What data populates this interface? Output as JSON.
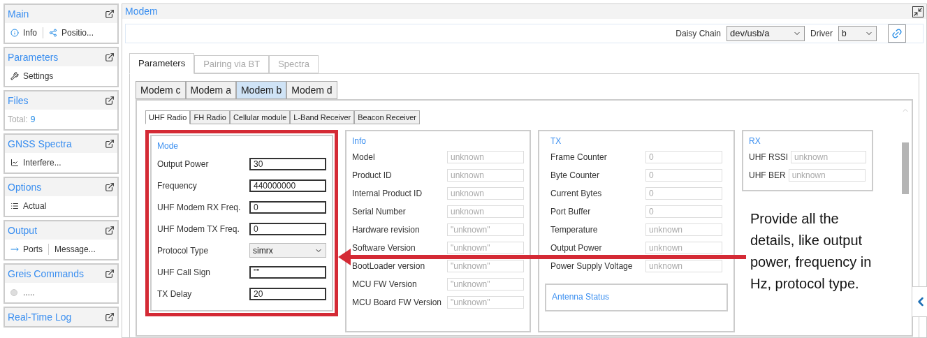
{
  "sidebar": {
    "panels": [
      {
        "title": "Main",
        "items": [
          {
            "kind": "info",
            "label": "Info"
          },
          {
            "kind": "position",
            "label": "Positio..."
          }
        ]
      },
      {
        "title": "Parameters",
        "items": [
          {
            "kind": "settings",
            "label": "Settings"
          }
        ]
      },
      {
        "title": "Files",
        "items": [
          {
            "kind": "total",
            "label": "Total:",
            "value": "9"
          }
        ]
      },
      {
        "title": "GNSS Spectra",
        "items": [
          {
            "kind": "chart",
            "label": "Interfere..."
          }
        ]
      },
      {
        "title": "Options",
        "items": [
          {
            "kind": "list",
            "label": "Actual"
          }
        ]
      },
      {
        "title": "Output",
        "items": [
          {
            "kind": "ports",
            "label": "Ports"
          },
          {
            "kind": "text",
            "label": "Message..."
          }
        ]
      },
      {
        "title": "Greis Commands",
        "items": [
          {
            "kind": "status",
            "label": "....."
          }
        ]
      },
      {
        "title": "Real-Time Log"
      }
    ]
  },
  "main": {
    "title": "Modem",
    "toolbar": {
      "daisy_chain": {
        "label": "Daisy Chain",
        "value": "dev/usb/a"
      },
      "driver": {
        "label": "Driver",
        "value": "b"
      }
    },
    "tabs": [
      {
        "label": "Parameters",
        "selected": true,
        "disabled": false
      },
      {
        "label": "Pairing via BT",
        "selected": false,
        "disabled": true
      },
      {
        "label": "Spectra",
        "selected": false,
        "disabled": true
      }
    ],
    "modem_tabs": [
      {
        "label": "Modem c",
        "selected": false
      },
      {
        "label": "Modem a",
        "selected": false
      },
      {
        "label": "Modem b",
        "selected": true
      },
      {
        "label": "Modem d",
        "selected": false
      }
    ],
    "radio_tabs": [
      {
        "label": "UHF Radio",
        "selected": true
      },
      {
        "label": "FH Radio",
        "selected": false
      },
      {
        "label": "Cellular module",
        "selected": false
      },
      {
        "label": "L-Band Receiver",
        "selected": false
      },
      {
        "label": "Beacon Receiver",
        "selected": false
      }
    ],
    "mode": {
      "title": "Mode",
      "fields": [
        {
          "kind": "input",
          "label": "Output Power",
          "value": "30"
        },
        {
          "kind": "input",
          "label": "Frequency",
          "value": "440000000"
        },
        {
          "kind": "input",
          "label": "UHF Modem RX Freq.",
          "value": "0"
        },
        {
          "kind": "input",
          "label": "UHF Modem TX Freq.",
          "value": "0"
        },
        {
          "kind": "select",
          "label": "Protocol Type",
          "value": "simrx"
        },
        {
          "kind": "input",
          "label": "UHF Call Sign",
          "value": "\"\""
        },
        {
          "kind": "input",
          "label": "TX Delay",
          "value": "20"
        }
      ]
    },
    "info": {
      "title": "Info",
      "fields": [
        {
          "label": "Model",
          "value": "unknown"
        },
        {
          "label": "Product ID",
          "value": "unknown"
        },
        {
          "label": "Internal Product ID",
          "value": "unknown"
        },
        {
          "label": "Serial Number",
          "value": "unknown"
        },
        {
          "label": "Hardware revision",
          "value": "\"unknown\""
        },
        {
          "label": "Software Version",
          "value": "\"unknown\""
        },
        {
          "label": "BootLoader version",
          "value": "\"unknown\""
        },
        {
          "label": "MCU FW Version",
          "value": "\"unknown\""
        },
        {
          "label": "MCU Board FW Version",
          "value": "\"unknown\""
        }
      ]
    },
    "tx": {
      "title": "TX",
      "fields": [
        {
          "label": "Frame Counter",
          "value": "0"
        },
        {
          "label": "Byte Counter",
          "value": "0"
        },
        {
          "label": "Current Bytes",
          "value": "0"
        },
        {
          "label": "Port Buffer",
          "value": "0"
        },
        {
          "label": "Temperature",
          "value": "unknown"
        },
        {
          "label": "Output Power",
          "value": "unknown"
        },
        {
          "label": "Power Supply Voltage",
          "value": "unknown"
        }
      ],
      "antenna_status": {
        "title": "Antenna Status"
      }
    },
    "rx": {
      "title": "RX",
      "fields": [
        {
          "label": "UHF RSSI",
          "value": "unknown"
        },
        {
          "label": "UHF BER",
          "value": "unknown"
        }
      ]
    }
  },
  "annotation": {
    "text": "Provide all the details, like output power, frequency in Hz, protocol type."
  }
}
